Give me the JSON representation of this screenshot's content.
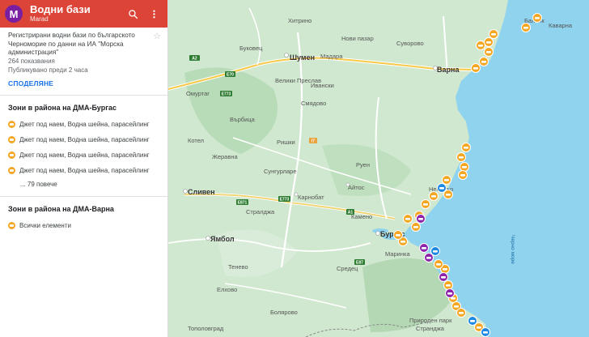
{
  "header": {
    "avatar_letter": "M",
    "title": "Водни бази",
    "owner": "Marad"
  },
  "info": {
    "description": "Регистрирани водни бази по българското Черноморие по данни на ИА \"Морска администрация\"",
    "views": "264 показвания",
    "published": "Публикувано преди 2 часа",
    "share_label": "СПОДЕЛЯНЕ"
  },
  "layers": [
    {
      "title": "Зони в района на ДМА-Бургас",
      "items": [
        "Джет под наем, Водна шейна, парасейлинг",
        "Джет под наем, Водна шейна, парасейлинг",
        "Джет под наем, Водна шейна, парасейлинг",
        "Джет под наем, Водна шейна, парасейлинг"
      ],
      "more": "... 79 повече"
    },
    {
      "title": "Зони в района на ДМА-Варна",
      "items": [
        "Всички елементи"
      ]
    }
  ],
  "colors": {
    "header": "#db4437",
    "avatar": "#7b1fa2",
    "land": "#cfe8cf",
    "sea": "#8fd3ee",
    "marker_orange": "#f5a623",
    "marker_blue": "#1e88e5",
    "marker_purple": "#8e24aa",
    "link": "#1a73e8"
  },
  "map_places": {
    "hitrino": "Хитрино",
    "novi_pazar": "Нови пазар",
    "suvorovo": "Суворово",
    "shumen": "Шумен",
    "madara": "Мадара",
    "varna": "Варна",
    "balchik": "Балчик",
    "kavarna": "Каварна",
    "bukovets": "Буковец",
    "veliki_preslav": "Велики Преслав",
    "ivanski": "Ивански",
    "smyadovo": "Смядово",
    "vrbitsa": "Върбица",
    "omurtag": "Омуртаг",
    "rishki": "Ришки",
    "kotel": "Котел",
    "zheravna": "Жеравна",
    "sungurlare": "Сунгурларе",
    "ruen": "Руен",
    "sliven": "Сливен",
    "karnobat": "Карнобат",
    "aytos": "Айтос",
    "nesebar": "Несебър",
    "straldzha": "Стралджа",
    "kameno": "Камено",
    "burgas": "Бургас",
    "yambol": "Ямбол",
    "marinka": "Маринка",
    "sredets": "Средец",
    "tenevo": "Тенево",
    "elhovo": "Елхово",
    "bolyarovo": "Болярово",
    "toplovgrad": "Тополовград",
    "prirodne": "Природен парк",
    "strandzha": "Странджа",
    "sea": "Черно море"
  },
  "road_labels": [
    "A2",
    "E70",
    "E773",
    "E871",
    "A1",
    "I7",
    "E87",
    "E773"
  ],
  "markers_summary": {
    "orange_count": 28,
    "blue_count": 4,
    "purple_count": 5
  }
}
